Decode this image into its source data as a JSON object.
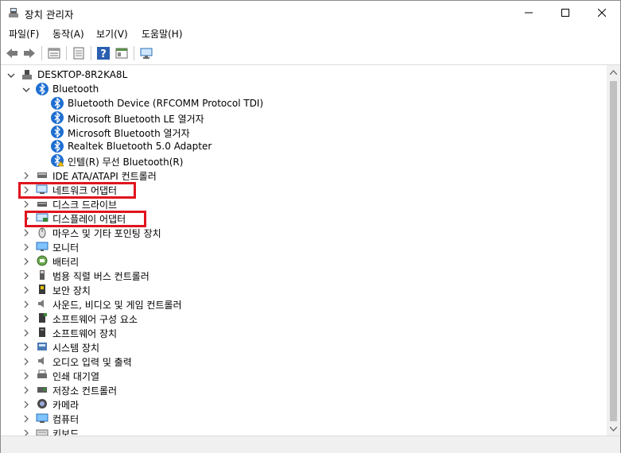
{
  "window": {
    "title": "장치 관리자",
    "controls": [
      "minimize",
      "maximize",
      "close"
    ]
  },
  "menu": {
    "file": "파일(F)",
    "action": "동작(A)",
    "view": "보기(V)",
    "help": "도움말(H)"
  },
  "toolbar": {
    "icons": [
      "back-arrow-icon",
      "forward-arrow-icon",
      "properties-icon",
      "refresh-icon",
      "help-icon",
      "view-icon",
      "monitor-icon"
    ]
  },
  "tree": {
    "root": "DESKTOP-8R2KA8L",
    "bluetooth": {
      "label": "Bluetooth",
      "children": [
        "Bluetooth Device (RFCOMM Protocol TDI)",
        "Microsoft Bluetooth LE 열거자",
        "Microsoft Bluetooth 열거자",
        "Realtek Bluetooth 5.0 Adapter",
        "인텔(R) 무선 Bluetooth(R)"
      ]
    },
    "categories": [
      "IDE ATA/ATAPI 컨트롤러",
      "네트워크 어댑터",
      "디스크 드라이브",
      "디스플레이 어댑터",
      "마우스 및 기타 포인팅 장치",
      "모니터",
      "배터리",
      "범용 직렬 버스 컨트롤러",
      "보안 장치",
      "사운드, 비디오 및 게임 컨트롤러",
      "소프트웨어 구성 요소",
      "소프트웨어 장치",
      "시스템 장치",
      "오디오 입력 및 출력",
      "인쇄 대기열",
      "저장소 컨트롤러",
      "카메라",
      "컴퓨터",
      "키보드"
    ]
  },
  "colors": {
    "highlight": "#e0141e",
    "bluetooth": "#1f6fd1"
  }
}
